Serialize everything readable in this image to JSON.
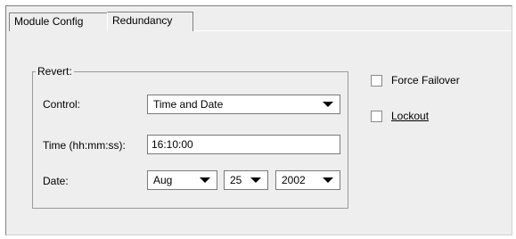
{
  "tabs": [
    {
      "label": "Module Config"
    },
    {
      "label": "Redundancy"
    }
  ],
  "revert": {
    "legend": "Revert:",
    "control_label": "Control:",
    "control_value": "Time and Date",
    "time_label": "Time (hh:mm:ss):",
    "time_value": "16:10:00",
    "date_label": "Date:",
    "month_value": "Aug",
    "day_value": "25",
    "year_value": "2002"
  },
  "options": {
    "force_failover": {
      "label": "Force Failover",
      "checked": false
    },
    "lockout": {
      "label": "Lockout",
      "checked": false
    }
  }
}
